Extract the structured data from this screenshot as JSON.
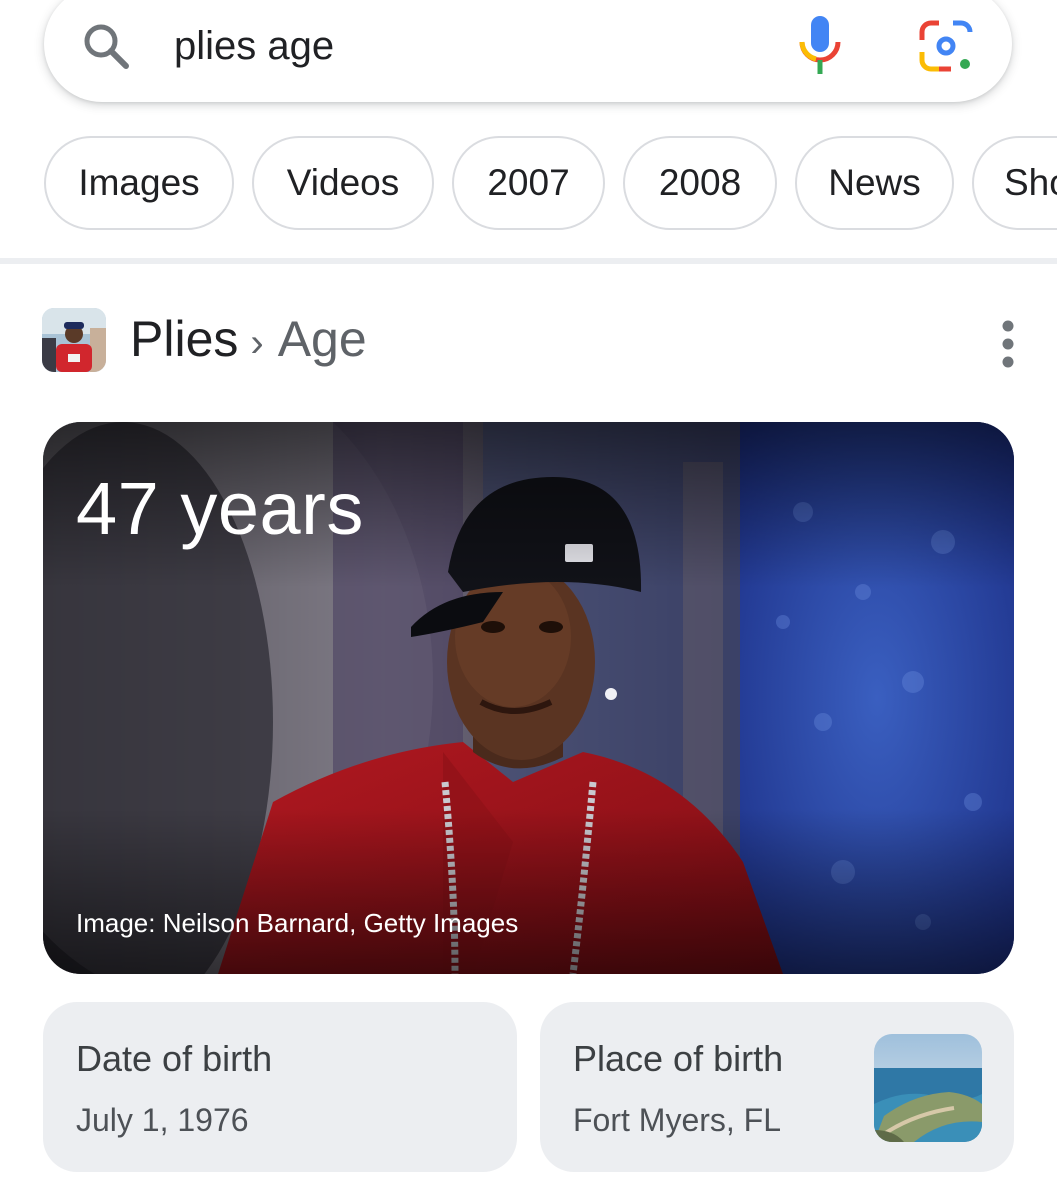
{
  "search": {
    "query": "plies age"
  },
  "chips": [
    {
      "label": "Images"
    },
    {
      "label": "Videos"
    },
    {
      "label": "2007"
    },
    {
      "label": "2008"
    },
    {
      "label": "News"
    },
    {
      "label": "Sho"
    }
  ],
  "header": {
    "entity": "Plies",
    "separator": "›",
    "attribute": "Age"
  },
  "hero": {
    "age": "47 years",
    "credit": "Image: Neilson Barnard, Getty Images"
  },
  "facts": [
    {
      "title": "Date of birth",
      "value": "July 1, 1976"
    },
    {
      "title": "Place of birth",
      "value": "Fort Myers, FL"
    }
  ],
  "colors": {
    "google_blue": "#4285F4",
    "google_red": "#EA4335",
    "google_yellow": "#FBBC05",
    "google_green": "#34A853",
    "chip_border": "#dadce0",
    "card_bg": "#eceef1"
  },
  "icons": [
    "search-icon",
    "mic-icon",
    "lens-icon",
    "more-vert-icon"
  ]
}
